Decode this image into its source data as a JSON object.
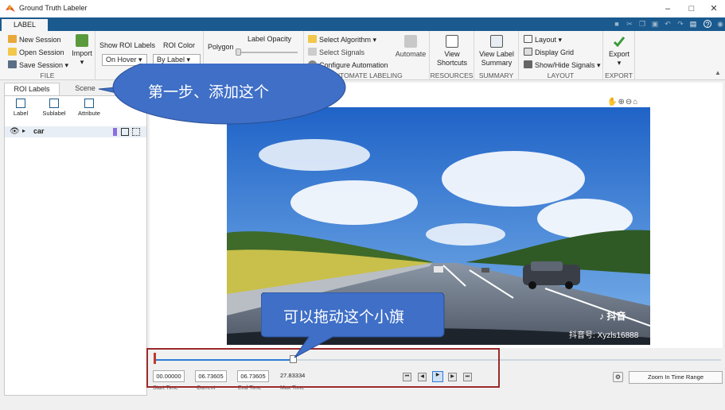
{
  "window": {
    "title": "Ground Truth Labeler",
    "minimize": "–",
    "maximize": "□",
    "close": "✕"
  },
  "tabbar": {
    "active_tab": "LABEL"
  },
  "ribbon": {
    "file": {
      "new_session": "New Session",
      "open_session": "Open Session",
      "save_session": "Save Session ▾",
      "import": "Import",
      "section": "FILE"
    },
    "roi": {
      "show_roi_labels": "Show ROI Labels",
      "roi_color": "ROI Color",
      "on_hover": "On Hover ▾",
      "by_label": "By Label ▾"
    },
    "polygon": {
      "label": "Polygon",
      "opacity": "Label Opacity"
    },
    "automate": {
      "select_algorithm": "Select Algorithm ▾",
      "select_signals": "Select Signals",
      "configure": "Configure Automation",
      "automate": "Automate",
      "section": "AUTOMATE LABELING"
    },
    "resources": {
      "view_shortcuts_1": "View",
      "view_shortcuts_2": "Shortcuts",
      "section": "RESOURCES"
    },
    "summary": {
      "view_label_1": "View Label",
      "view_label_2": "Summary",
      "section": "SUMMARY"
    },
    "layout": {
      "layout": "Layout ▾",
      "display_grid": "Display Grid",
      "show_hide": "Show/Hide Signals ▾",
      "section": "LAYOUT"
    },
    "export": {
      "export": "Export",
      "arrow": "▾",
      "section": "EXPORT"
    }
  },
  "panel": {
    "tab_roi": "ROI Labels",
    "tab_scene": "Scene",
    "tool_label": "Label",
    "tool_sublabel": "Sublabel",
    "tool_attribute": "Attribute",
    "item": "car"
  },
  "timeline": {
    "start_time": "00.00000",
    "current": "06.73605",
    "end_time": "06.73605",
    "max_time": "27.83334",
    "start_label": "Start Time",
    "current_label": "Current",
    "end_label": "End Time",
    "max_label": "Max Time",
    "zoom": "Zoom In Time Range",
    "progress": 0.242
  },
  "video": {
    "watermark_brand": "抖音",
    "watermark_id": "抖音号: Xyzls16888"
  },
  "callouts": {
    "step1": "第一步、添加这个",
    "drag": "可以拖动这个小旗"
  },
  "colors": {
    "accent": "#1b5a8e",
    "callout": "#3f6fc7",
    "highlight": "#9b2a2a"
  }
}
